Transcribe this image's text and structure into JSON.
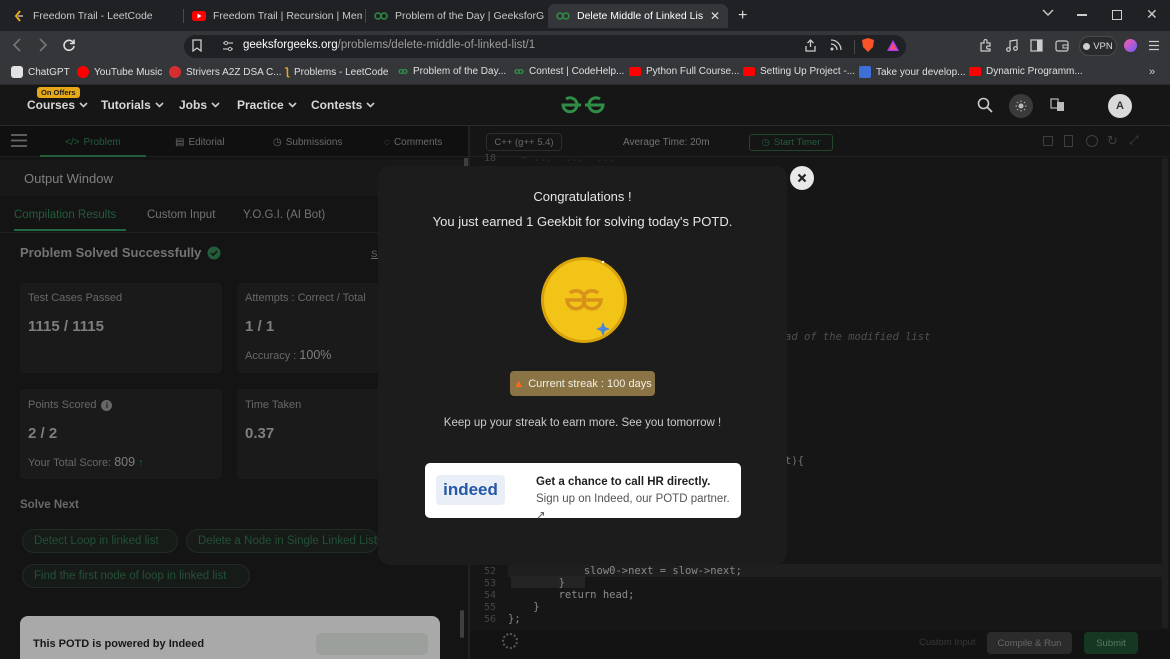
{
  "browser": {
    "tabs": [
      {
        "title": "Freedom Trail - LeetCode",
        "favicon": "leetcode-icon",
        "active": false
      },
      {
        "title": "Freedom Trail | Recursion | Memoizat",
        "favicon": "youtube-icon",
        "active": false
      },
      {
        "title": "Problem of the Day | GeeksforGeeks",
        "favicon": "gfg-icon",
        "active": false
      },
      {
        "title": "Delete Middle of Linked List | Pr",
        "favicon": "gfg-icon",
        "active": true
      }
    ],
    "url_host": "geeksforgeeks.org",
    "url_path": "/problems/delete-middle-of-linked-list/1",
    "vpn_label": "VPN",
    "bookmarks": [
      {
        "label": "ChatGPT",
        "icon": "chatgpt-icon"
      },
      {
        "label": "YouTube Music",
        "icon": "youtube-music-icon"
      },
      {
        "label": "Strivers A2Z DSA C...",
        "icon": "tuf-icon"
      },
      {
        "label": "Problems - LeetCode",
        "icon": "leetcode-icon"
      },
      {
        "label": "Problem of the Day...",
        "icon": "gfg-icon"
      },
      {
        "label": "Contest | CodeHelp...",
        "icon": "gfg-icon"
      },
      {
        "label": "Python Full Course...",
        "icon": "youtube-icon"
      },
      {
        "label": "Setting Up Project -...",
        "icon": "youtube-icon"
      },
      {
        "label": "Take your develop...",
        "icon": "site-icon"
      },
      {
        "label": "Dynamic Programm...",
        "icon": "youtube-icon"
      }
    ]
  },
  "gfg_nav": {
    "offers_badge": "On Offers",
    "items": [
      "Courses",
      "Tutorials",
      "Jobs",
      "Practice",
      "Contests"
    ],
    "avatar_letter": "A"
  },
  "problem_tabs": [
    "Problem",
    "Editorial",
    "Submissions",
    "Comments"
  ],
  "output": {
    "title": "Output Window",
    "tabs": [
      "Compilation Results",
      "Custom Input",
      "Y.O.G.I. (AI Bot)"
    ],
    "status": "Problem Solved Successfully",
    "side_link": "Su",
    "test_cases_label": "Test Cases Passed",
    "test_cases_value": "1115 / 1115",
    "attempts_label": "Attempts : Correct / Total",
    "attempts_value": "1 / 1",
    "accuracy_label": "Accuracy :",
    "accuracy_value": "100%",
    "points_label": "Points Scored",
    "points_value": "2 / 2",
    "total_score_label": "Your Total Score:",
    "total_score_value": "809",
    "time_label": "Time Taken",
    "time_value": "0.37",
    "solve_next_label": "Solve Next",
    "solve_next": [
      "Detect Loop in linked list",
      "Delete a Node in Single Linked List",
      "Find the first node of loop in linked list"
    ],
    "potd_text": "This POTD is powered by Indeed"
  },
  "editor": {
    "language": "C++ (g++ 5.4)",
    "average_time": "Average Time: 20m",
    "timer_label": "Start Timer",
    "top_line_num": "18",
    "top_line_code": "  ~ ...  ...  ...",
    "comment_fragment": "ad of the modified list",
    "line_fragment": "t){",
    "lines": [
      {
        "num": "52",
        "code": "            slow0->next = slow->next;"
      },
      {
        "num": "53",
        "code": "        }"
      },
      {
        "num": "54",
        "code": "        return head;"
      },
      {
        "num": "55",
        "code": "    }"
      },
      {
        "num": "56",
        "code": "};"
      }
    ],
    "custom_input": "Custom Input",
    "compile_run": "Compile & Run",
    "submit": "Submit"
  },
  "modal": {
    "title": "Congratulations !",
    "message": "You just earned 1 Geekbit for solving today's POTD.",
    "streak": "Current streak : 100 days",
    "keep_up": "Keep up your streak to earn more. See you tomorrow !",
    "partner_bold": "Get a chance to call HR directly.",
    "partner_rest": "Sign up on Indeed, our POTD partner.",
    "partner_logo": "indeed"
  },
  "colors": {
    "gfg_green": "#2f8d46",
    "coin": "#f2c418",
    "streak_bg": "#8a7445"
  }
}
